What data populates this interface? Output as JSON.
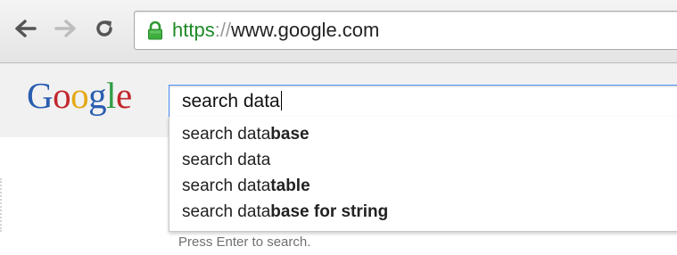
{
  "browser": {
    "url_scheme": "https",
    "url_sep": "://",
    "url_host": "www.google.com",
    "icons": [
      "back-arrow-icon",
      "forward-arrow-icon",
      "reload-icon",
      "lock-icon"
    ],
    "secure_color": "#1e8a26"
  },
  "google": {
    "logo_letters": [
      "G",
      "o",
      "o",
      "g",
      "l",
      "e"
    ],
    "logo_colors": [
      "#2a5db0",
      "#c1272d",
      "#e4a916",
      "#2a5db0",
      "#2f9e44",
      "#c1272d"
    ],
    "search_value": "search data",
    "suggestions": [
      {
        "plain": "search data",
        "bold": "base"
      },
      {
        "plain": "search data",
        "bold": ""
      },
      {
        "plain": "search data",
        "bold": "table"
      },
      {
        "plain": "search data",
        "bold": "base for string"
      }
    ],
    "hint": "Press Enter to search."
  }
}
